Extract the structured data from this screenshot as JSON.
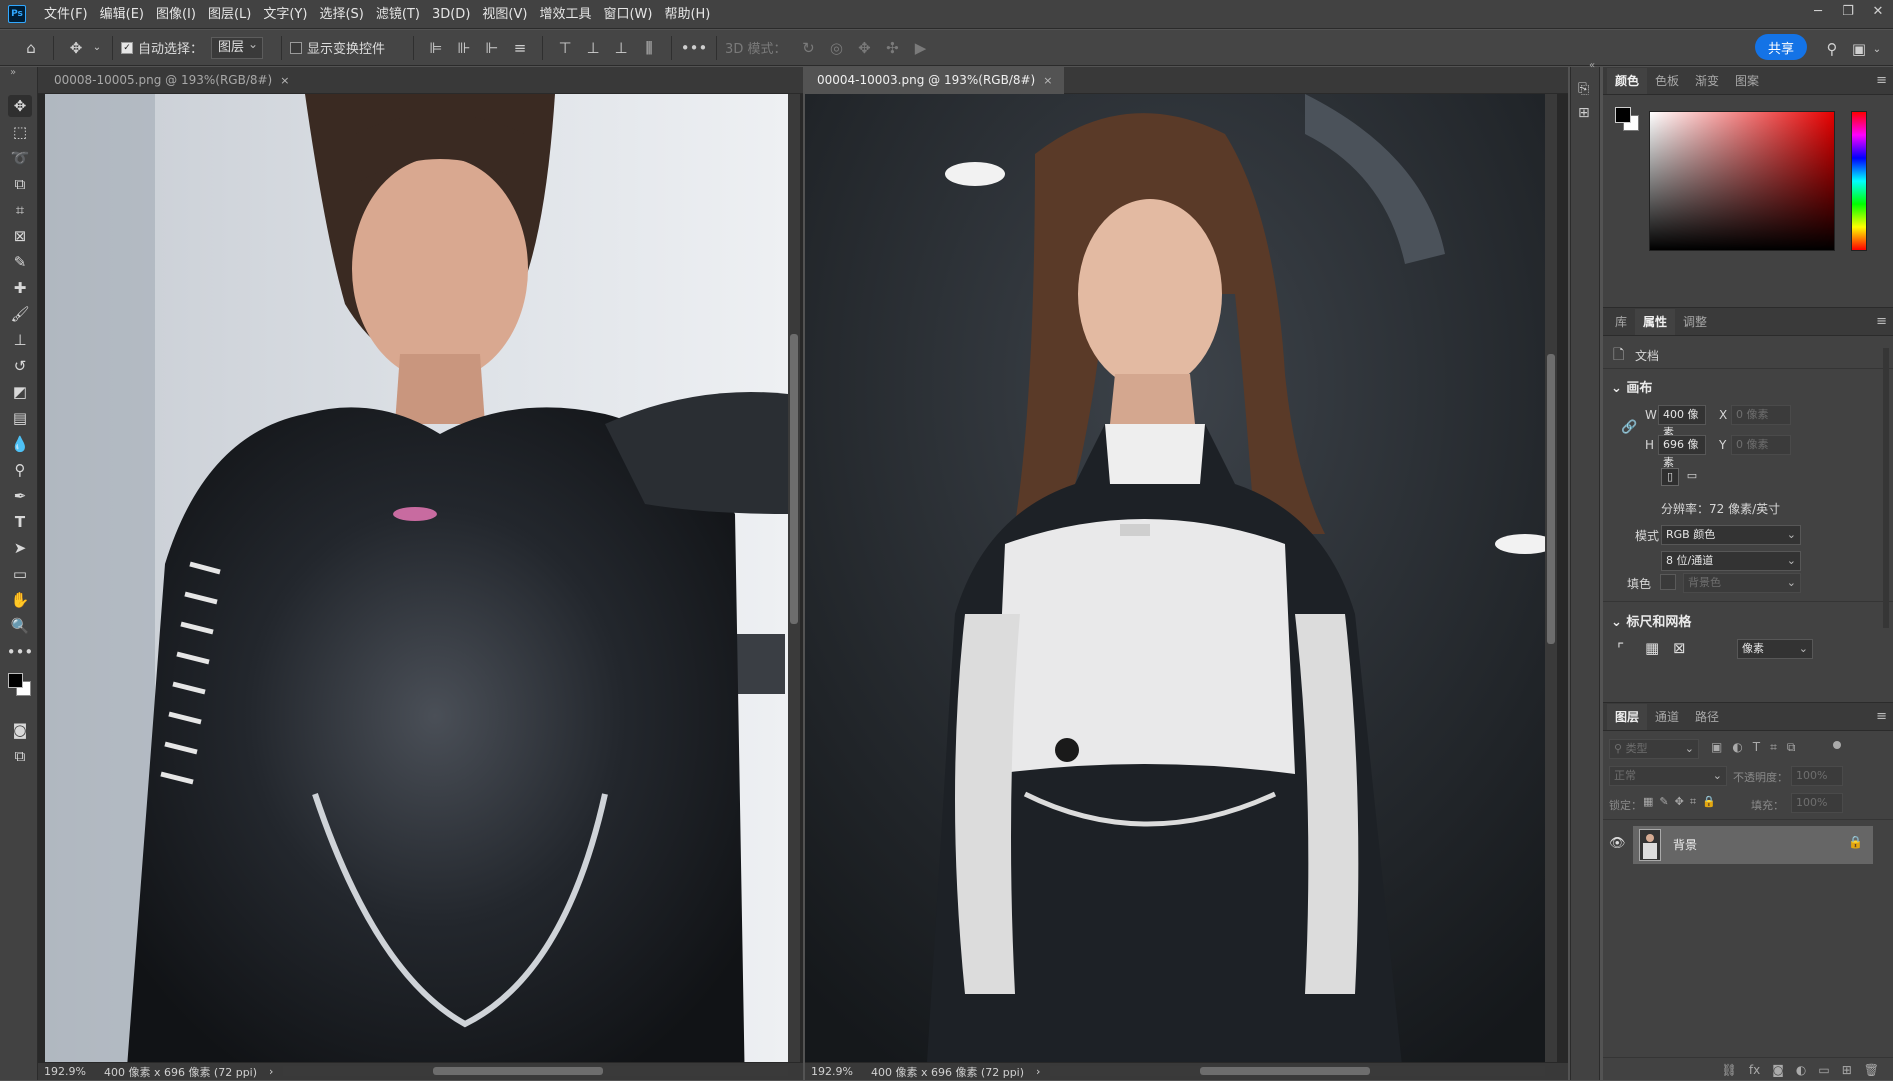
{
  "app": {
    "logo": "Ps",
    "menu": [
      "文件(F)",
      "编辑(E)",
      "图像(I)",
      "图层(L)",
      "文字(Y)",
      "选择(S)",
      "滤镜(T)",
      "3D(D)",
      "视图(V)",
      "增效工具",
      "窗口(W)",
      "帮助(H)"
    ]
  },
  "options": {
    "auto_select_label": "自动选择：",
    "auto_select_value": "图层",
    "show_transform_label": "显示变换控件",
    "mode_3d_label": "3D 模式：",
    "more": "•••",
    "share_label": "共享"
  },
  "documents": [
    {
      "tab_title": "00008-10005.png @ 193%(RGB/8#)",
      "zoom": "192.9%",
      "size_info": "400 像素 x 696 像素 (72 ppi)"
    },
    {
      "tab_title": "00004-10003.png @ 193%(RGB/8#)",
      "zoom": "192.9%",
      "size_info": "400 像素 x 696 像素 (72 ppi)"
    }
  ],
  "color_panel": {
    "tabs": [
      "颜色",
      "色板",
      "渐变",
      "图案"
    ],
    "foreground": "#000000",
    "background": "#ffffff",
    "hue_color": "#e60000"
  },
  "properties_panel": {
    "tabs": [
      "库",
      "属性",
      "调整"
    ],
    "doc_label": "文档",
    "canvas_section": "画布",
    "w_label": "W",
    "w_value": "400 像素",
    "h_label": "H",
    "h_value": "696 像素",
    "x_label": "X",
    "x_value": "0 像素",
    "y_label": "Y",
    "y_value": "0 像素",
    "resolution": "分辨率：72 像素/英寸",
    "mode_label": "模式",
    "mode_value": "RGB 颜色",
    "depth_value": "8 位/通道",
    "fill_label": "填色",
    "fill_value": "背景色",
    "rulers_section": "标尺和网格",
    "units_value": "像素"
  },
  "layers_panel": {
    "tabs": [
      "图层",
      "通道",
      "路径"
    ],
    "filter_placeholder": "类型",
    "blend_mode": "正常",
    "opacity_label": "不透明度：",
    "opacity_value": "100%",
    "lock_label": "锁定：",
    "fill_label": "填充：",
    "fill_value": "100%",
    "layers": [
      {
        "name": "背景"
      }
    ]
  }
}
